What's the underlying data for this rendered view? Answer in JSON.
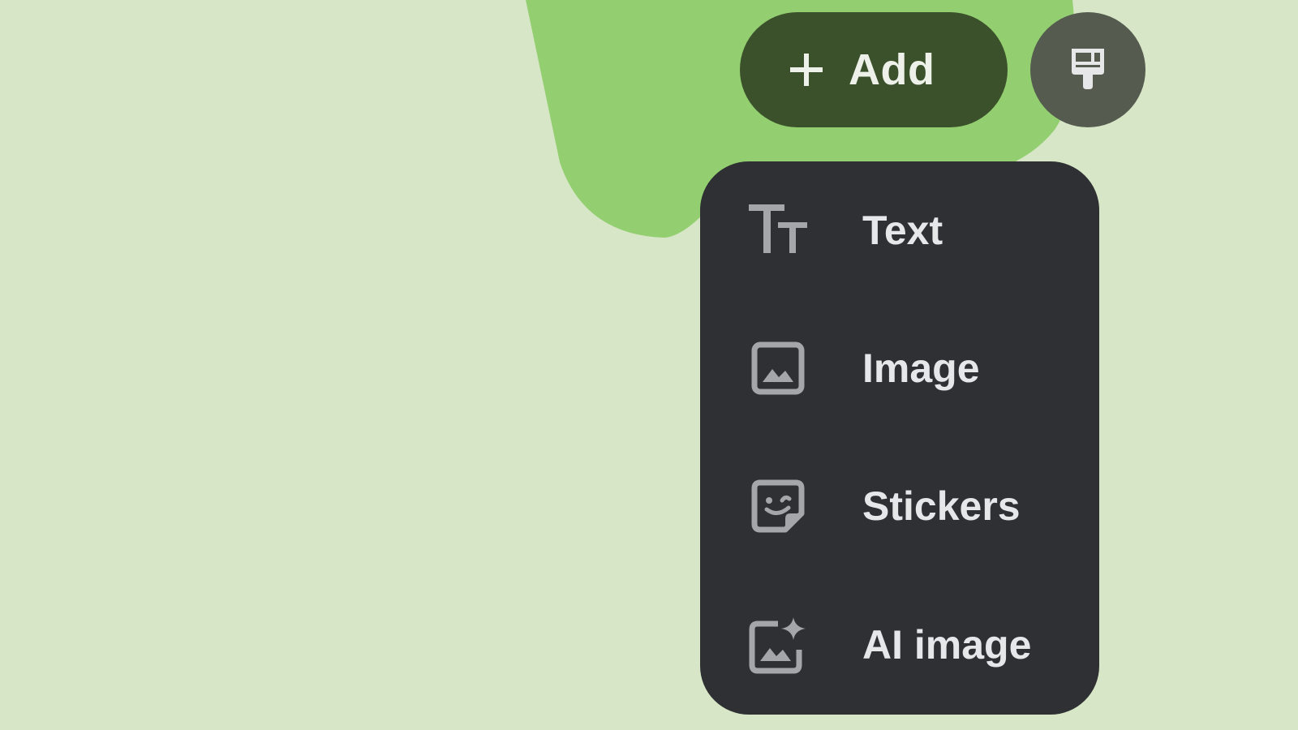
{
  "toolbar": {
    "add_label": "Add",
    "add_icon": "plus-icon",
    "brush_icon": "paint-brush-icon"
  },
  "menu": {
    "items": [
      {
        "label": "Text",
        "icon": "text-format-icon"
      },
      {
        "label": "Image",
        "icon": "image-icon"
      },
      {
        "label": "Stickers",
        "icon": "sticker-icon"
      },
      {
        "label": "AI image",
        "icon": "ai-image-icon"
      }
    ]
  },
  "colors": {
    "background": "#d7e6c7",
    "accent_blob": "#93cf70",
    "add_button": "#3b512b",
    "brush_button": "#555c4f",
    "menu_background": "#2e3033",
    "menu_text": "#e6e7e9",
    "menu_icon": "#a4a6aa"
  }
}
